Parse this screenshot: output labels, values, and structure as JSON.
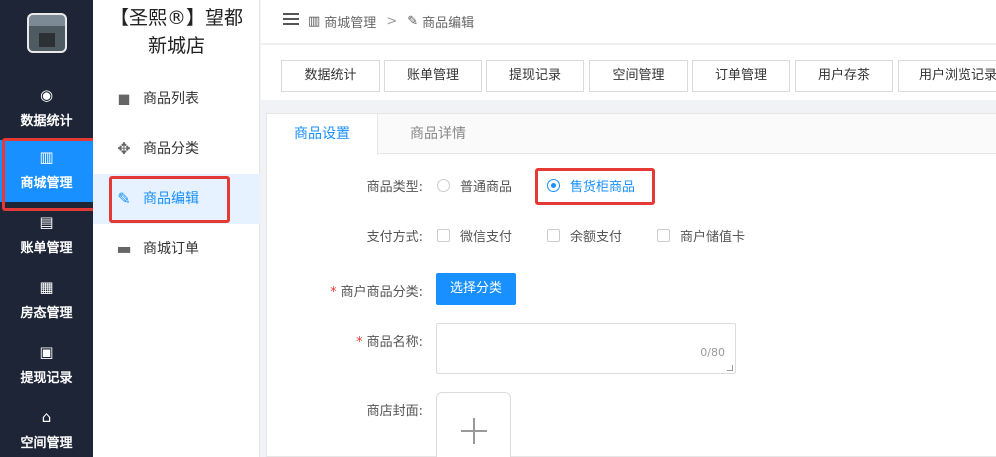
{
  "rail": {
    "items": [
      {
        "label": "数据统计",
        "icon": "dashboard-icon"
      },
      {
        "label": "商城管理",
        "icon": "store-icon"
      },
      {
        "label": "账单管理",
        "icon": "bill-icon"
      },
      {
        "label": "房态管理",
        "icon": "building-icon"
      },
      {
        "label": "提现记录",
        "icon": "cash-icon"
      },
      {
        "label": "空间管理",
        "icon": "home-icon"
      }
    ]
  },
  "submenu": {
    "shop_name_line1": "【圣熙®】望都",
    "shop_name_line2": "新城店",
    "items": [
      {
        "label": "商品列表",
        "icon": "bag-icon"
      },
      {
        "label": "商品分类",
        "icon": "move-icon"
      },
      {
        "label": "商品编辑",
        "icon": "edit-icon"
      },
      {
        "label": "商城订单",
        "icon": "shop-icon"
      }
    ]
  },
  "breadcrumb": {
    "level1": "商城管理",
    "separator": ">",
    "level2": "商品编辑"
  },
  "tags": [
    "数据统计",
    "账单管理",
    "提现记录",
    "空间管理",
    "订单管理",
    "用户存茶",
    "用户浏览记录"
  ],
  "tabs": {
    "active": "商品设置",
    "other": "商品详情"
  },
  "form": {
    "type_label": "商品类型:",
    "type_options": [
      "普通商品",
      "售货柜商品"
    ],
    "pay_label": "支付方式:",
    "pay_options": [
      "微信支付",
      "余额支付",
      "商户储值卡"
    ],
    "category_label": "商户商品分类:",
    "category_button": "选择分类",
    "name_label": "商品名称:",
    "name_counter": "0/80",
    "cover_label": "商店封面:",
    "required_mark": "*"
  },
  "colors": {
    "primary": "#1890ff",
    "rail_bg": "#1d2536",
    "highlight": "#e53935"
  }
}
